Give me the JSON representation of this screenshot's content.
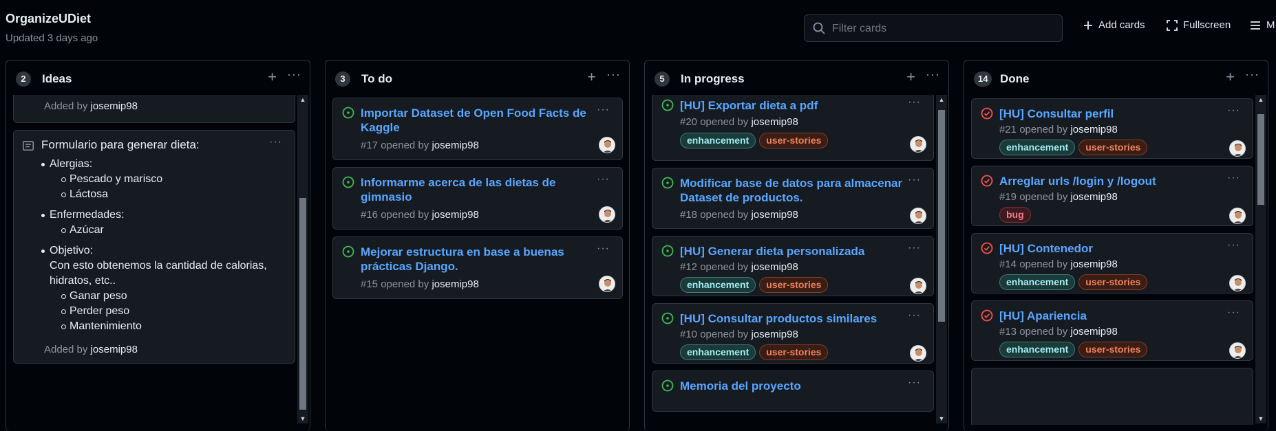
{
  "project": {
    "title": "OrganizeUDiet",
    "updated": "Updated 3 days ago"
  },
  "toolbar": {
    "filter_placeholder": "Filter cards",
    "add_cards": "Add cards",
    "fullscreen": "Fullscreen",
    "menu": "M"
  },
  "columns": [
    {
      "name": "Ideas",
      "count": "2",
      "notes": [
        {
          "added_prefix": "Added by",
          "added_user": "josemip98"
        },
        {
          "title": "Formulario para generar dieta:",
          "allergies": "Alergias:",
          "allergy_items": [
            "Pescado y marisco",
            "Láctosa"
          ],
          "diseases": "Enfermedades:",
          "disease_items": [
            "Azúcar"
          ],
          "objective": "Objetivo:",
          "objective_desc": "Con esto obtenemos la cantidad de calorias, hidratos, etc..",
          "objective_items": [
            "Ganar peso",
            "Perder peso",
            "Mantenimiento"
          ],
          "added_prefix": "Added by",
          "added_user": "josemip98"
        }
      ]
    },
    {
      "name": "To do",
      "count": "3",
      "cards": [
        {
          "title": "Importar Dataset de Open Food Facts de Kaggle",
          "meta": "#17 opened by",
          "user": "josemip98"
        },
        {
          "title": "Informarme acerca de las dietas de gimnasio",
          "meta": "#16 opened by",
          "user": "josemip98"
        },
        {
          "title": "Mejorar estructura en base a buenas prácticas Django.",
          "meta": "#15 opened by",
          "user": "josemip98"
        }
      ]
    },
    {
      "name": "In progress",
      "count": "5",
      "cards": [
        {
          "title": "[HU] Exportar dieta a pdf",
          "meta": "#20 opened by",
          "user": "josemip98",
          "labels": [
            "enhancement",
            "user-stories"
          ]
        },
        {
          "title": "Modificar base de datos para almacenar Dataset de productos.",
          "meta": "#18 opened by",
          "user": "josemip98"
        },
        {
          "title": "[HU] Generar dieta personalizada",
          "meta": "#12 opened by",
          "user": "josemip98",
          "labels": [
            "enhancement",
            "user-stories"
          ]
        },
        {
          "title": "[HU] Consultar productos similares",
          "meta": "#10 opened by",
          "user": "josemip98",
          "labels": [
            "enhancement",
            "user-stories"
          ]
        },
        {
          "title": "Memoria del proyecto"
        }
      ]
    },
    {
      "name": "Done",
      "count": "14",
      "cards": [
        {
          "title": "[HU] Consultar perfil",
          "meta": "#21 opened by",
          "user": "josemip98",
          "labels": [
            "enhancement",
            "user-stories"
          ]
        },
        {
          "title": "Arreglar urls /login y /logout",
          "meta": "#19 opened by",
          "user": "josemip98",
          "labels": [
            "bug"
          ]
        },
        {
          "title": "[HU] Contenedor",
          "meta": "#14 opened by",
          "user": "josemip98",
          "labels": [
            "enhancement",
            "user-stories"
          ]
        },
        {
          "title": "[HU] Apariencia",
          "meta": "#13 opened by",
          "user": "josemip98",
          "labels": [
            "enhancement",
            "user-stories"
          ]
        }
      ]
    }
  ],
  "colors": {
    "open": "#3fb950",
    "closed": "#f85149",
    "link": "#58a6ff",
    "bg": "#010409",
    "card": "#161b22"
  }
}
